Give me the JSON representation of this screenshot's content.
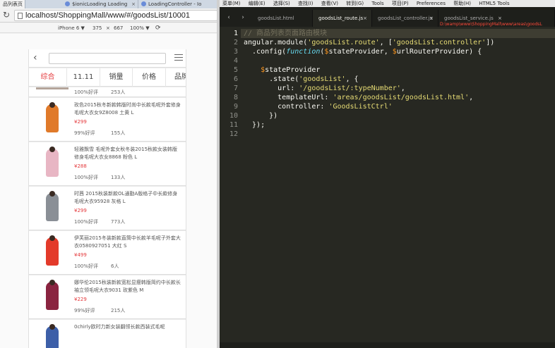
{
  "browser": {
    "tabs": [
      {
        "label": "品列表页",
        "active": true
      },
      {
        "label": "$ionicLoading Loading",
        "active": false
      },
      {
        "label": "LoadingController - Io",
        "active": false
      }
    ],
    "url": "localhost/ShoppingMall/www/#/goodsList/10001",
    "device": {
      "model": "iPhone 6 ▼",
      "width": "375",
      "times": "×",
      "height": "667",
      "zoom": "100% ▼"
    }
  },
  "app": {
    "sort_tabs": [
      "综合",
      "11.11",
      "销量",
      "价格",
      "品牌"
    ],
    "partial_top": {
      "rate": "100%好评",
      "count": "253人"
    },
    "products": [
      {
        "title": "玫色2015秋冬新款韩版时尚中长款毛呢外套修身毛呢大衣女9Z8008 土黄 L",
        "price": "¥299",
        "rate": "99%好评",
        "count": "155人",
        "color": "#e07a2a"
      },
      {
        "title": "轻雅飘雪 毛呢外套女秋冬装2015秋款女装韩版修身毛呢大衣女8868 粉色 L",
        "price": "¥288",
        "rate": "100%好评",
        "count": "133人",
        "color": "#e8b6c4"
      },
      {
        "title": "时茜 2015秋装新款OL通勤A版格子中长款修身毛呢大衣95928 灰格 L",
        "price": "¥299",
        "rate": "100%好评",
        "count": "773人",
        "color": "#8a8f96"
      },
      {
        "title": "伊芙丽2015冬装新款直筒中长款羊毛呢子外套大衣0580927051 大红 S",
        "price": "¥499",
        "rate": "100%好评",
        "count": "6人",
        "color": "#e33a2a"
      },
      {
        "title": "娜华伦2015秋装新款宽松显瘦韩版简约中长款长袖立领毛呢大衣9031 玫紫色 M",
        "price": "¥229",
        "rate": "99%好评",
        "count": "215人",
        "color": "#8a2440"
      },
      {
        "title": "0chirly欧时力新女装翻领长款西装式毛呢",
        "price": "",
        "rate": "",
        "count": "",
        "color": "#3d5fa8"
      }
    ]
  },
  "editor": {
    "menu": [
      "菜单(M)",
      "编辑(E)",
      "选择(S)",
      "查找(I)",
      "查看(V)",
      "转到(G)",
      "Tools",
      "项目(P)",
      "Preferences",
      "帮助(H)",
      "HTML5 Tools"
    ],
    "tabs": [
      {
        "label": "goodsList.html",
        "active": false,
        "closable": false
      },
      {
        "label": "goodsList_route.js",
        "active": true,
        "closable": true
      },
      {
        "label": "goodsList_controller.js",
        "active": false,
        "closable": true
      },
      {
        "label": "goodsList_service.js",
        "active": false,
        "closable": true
      }
    ],
    "path_tooltip": "D:\\wamp\\www\\ShoppingMall\\www\\areas\\goodsL",
    "lines": [
      "// 商品列表页面路由模块",
      "angular.module('goodsList.route', ['goodsList.controller'])",
      "  .config(function($stateProvider, $urlRouterProvider) {",
      "",
      "    $stateProvider",
      "      .state('goodsList', {",
      "        url: '/goodsList/:typeNumber',",
      "        templateUrl: 'areas/goodsList/goodsList.html',",
      "        controller: 'GoodsListCtrl'",
      "      })",
      "  });",
      ""
    ],
    "line_numbers": [
      "1",
      "2",
      "3",
      "4",
      "5",
      "6",
      "7",
      "8",
      "9",
      "10",
      "11",
      "12"
    ],
    "colors": {
      "string": "#e6db74",
      "keyword": "#66d9ef",
      "variable": "#fd971f",
      "comment": "#75715e",
      "plain": "#f8f8f2",
      "background": "#272822"
    }
  }
}
